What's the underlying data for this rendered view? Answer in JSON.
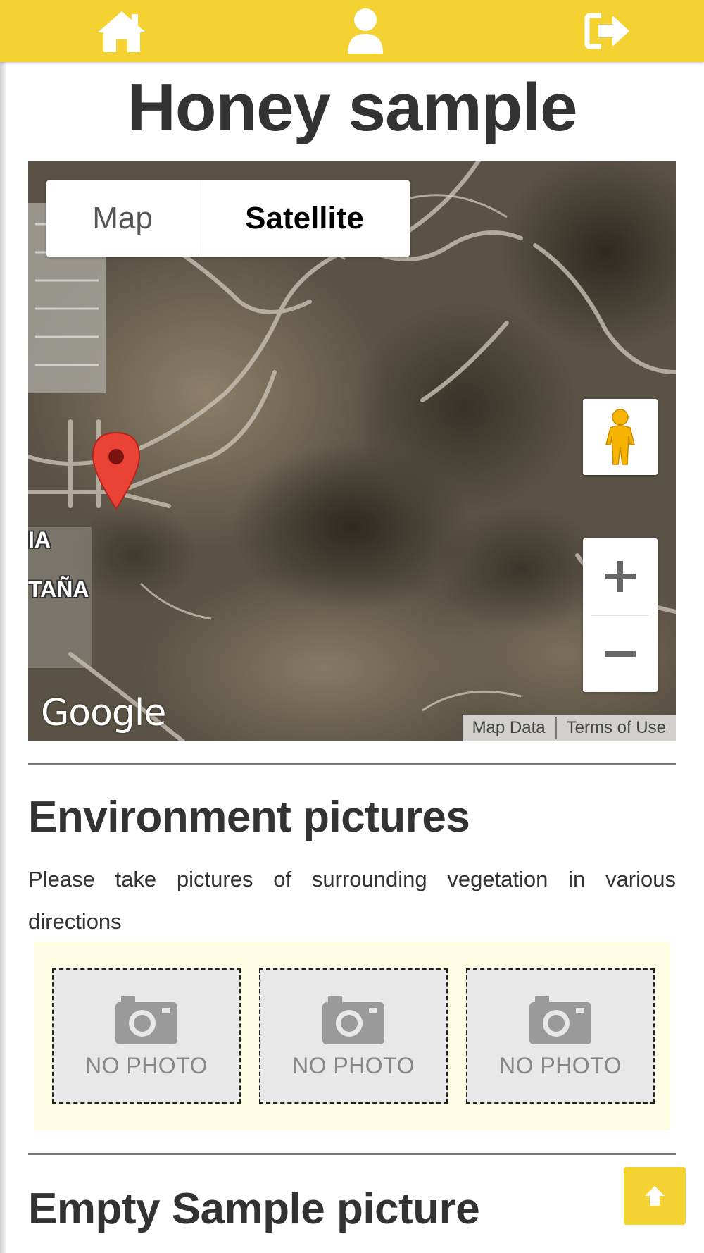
{
  "nav": {
    "home_icon": "home-icon",
    "user_icon": "user-icon",
    "logout_icon": "logout-icon",
    "bar_color": "#f4d232"
  },
  "page": {
    "title": "Honey sample"
  },
  "map": {
    "type_options": [
      "Map",
      "Satellite"
    ],
    "selected_type": "Satellite",
    "attribution": {
      "map_data": "Map Data",
      "terms": "Terms of Use"
    },
    "logo_text": "Google",
    "place_labels": [
      "IA",
      "TAÑA"
    ],
    "marker_color": "#ea4335"
  },
  "environment": {
    "heading": "Environment pictures",
    "description": "Please take pictures of surrounding vegetation in various directions",
    "photos": [
      {
        "label": "NO PHOTO"
      },
      {
        "label": "NO PHOTO"
      },
      {
        "label": "NO PHOTO"
      }
    ],
    "area_color": "#fffde3"
  },
  "empty_sample": {
    "heading": "Empty Sample picture"
  }
}
